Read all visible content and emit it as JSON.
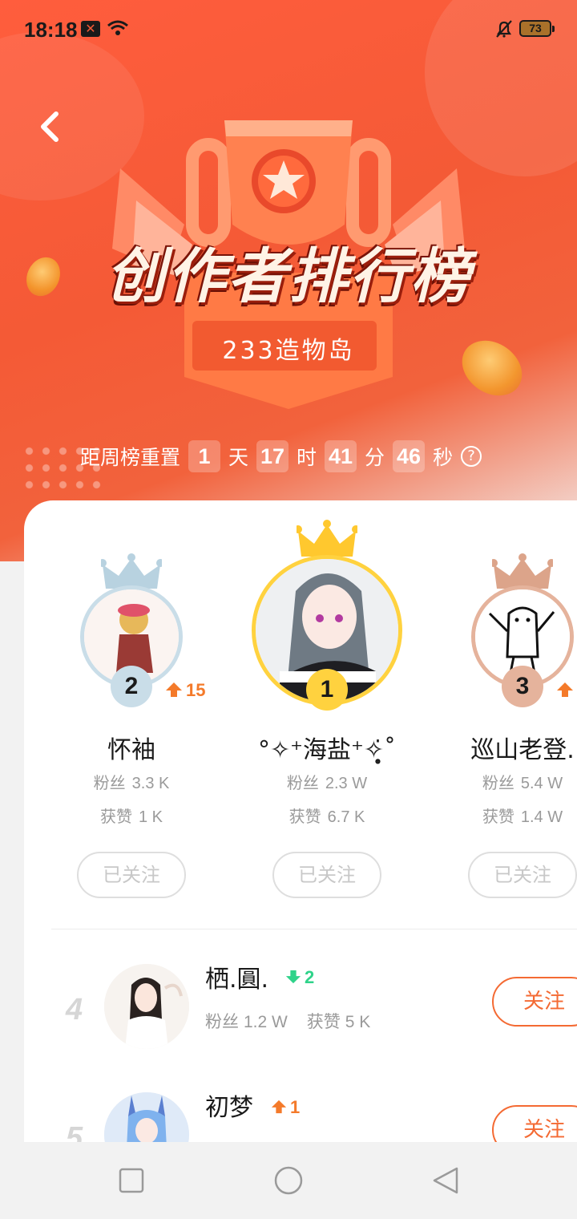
{
  "status_bar": {
    "time": "18:18",
    "battery": "73"
  },
  "banner": {
    "title": "创作者排行榜",
    "subtitle": "233造物岛"
  },
  "countdown": {
    "prefix": "距周榜重置",
    "days": "1",
    "days_unit": "天",
    "hours": "17",
    "hours_unit": "时",
    "minutes": "41",
    "minutes_unit": "分",
    "seconds": "46",
    "seconds_unit": "秒",
    "help_icon": "?"
  },
  "labels": {
    "fans": "粉丝",
    "likes": "获赞",
    "followed": "已关注",
    "follow": "关注"
  },
  "podium": [
    {
      "rank": "1",
      "name": "°✧⁺海盐⁺✧̣̥̇˚",
      "fans": "2.3 W",
      "likes": "6.7 K",
      "button": "已关注"
    },
    {
      "rank": "2",
      "name": "怀袖",
      "fans": "3.3 K",
      "likes": "1 K",
      "trend_dir": "up",
      "trend": "15",
      "button": "已关注"
    },
    {
      "rank": "3",
      "name": "巡山老登.",
      "fans": "5.4 W",
      "likes": "1.4 W",
      "trend_dir": "up",
      "button": "已关注"
    }
  ],
  "list": [
    {
      "rank": "4",
      "name": "栖.圓.",
      "trend_dir": "down",
      "trend": "2",
      "fans": "1.2 W",
      "likes": "5 K",
      "button": "关注"
    },
    {
      "rank": "5",
      "name": "初梦",
      "trend_dir": "up",
      "trend": "1",
      "button": "关注"
    }
  ],
  "colors": {
    "accent": "#f46a33",
    "up": "#f47a2a",
    "down": "#2fd38a",
    "gold": "#ffd23f",
    "silver": "#c9dde8",
    "bronze": "#e5b39c"
  },
  "icons": {
    "back": "chevron-left-icon",
    "crown": "crown-icon",
    "arrow_up": "arrow-up-icon",
    "arrow_down": "arrow-down-icon",
    "nav_recent": "square-icon",
    "nav_home": "circle-icon",
    "nav_back": "triangle-back-icon"
  }
}
